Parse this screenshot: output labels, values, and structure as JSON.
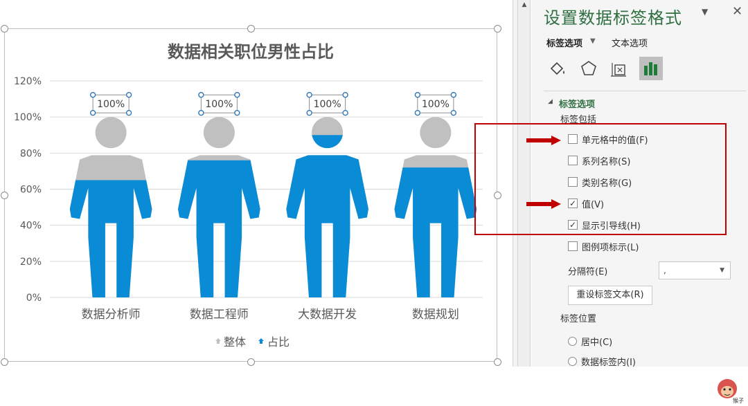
{
  "chart_data": {
    "type": "bar",
    "title": "数据相关职位男性占比",
    "categories": [
      "数据分析师",
      "数据工程师",
      "大数据开发",
      "数据规划"
    ],
    "series": [
      {
        "name": "整体",
        "values": [
          1.0,
          1.0,
          1.0,
          1.0
        ]
      },
      {
        "name": "占比",
        "values": [
          0.65,
          0.76,
          0.9,
          0.72
        ]
      }
    ],
    "data_labels": [
      "100%",
      "100%",
      "100%",
      "100%"
    ],
    "yticks": [
      "0%",
      "20%",
      "40%",
      "60%",
      "80%",
      "100%",
      "120%"
    ],
    "ylim": [
      0,
      1.2
    ],
    "grid": true,
    "legend": "bottom",
    "colors": {
      "overall": "#c0c0c0",
      "ratio": "#0a8bd6"
    }
  },
  "pane": {
    "title": "设置数据标签格式",
    "tab_label_options": "标签选项",
    "tab_text_options": "文本选项",
    "section_label_options": "标签选项",
    "label_contains": "标签包括",
    "options": [
      {
        "label": "单元格中的值(F)",
        "checked": false
      },
      {
        "label": "系列名称(S)",
        "checked": false
      },
      {
        "label": "类别名称(G)",
        "checked": false
      },
      {
        "label": "值(V)",
        "checked": true
      },
      {
        "label": "显示引导线(H)",
        "checked": true
      },
      {
        "label": "图例项标示(L)",
        "checked": false
      }
    ],
    "separator_label": "分隔符(E)",
    "separator_value": ",",
    "reset_button": "重设标签文本(R)",
    "label_position": "标签位置",
    "positions": [
      "居中(C)",
      "数据标签内(I)"
    ]
  },
  "logo_text": "猴子",
  "icons": [
    "fill-icon",
    "pentagon-icon",
    "size-properties-icon",
    "bar-chart-icon",
    "close-icon",
    "dropdown-icon"
  ]
}
